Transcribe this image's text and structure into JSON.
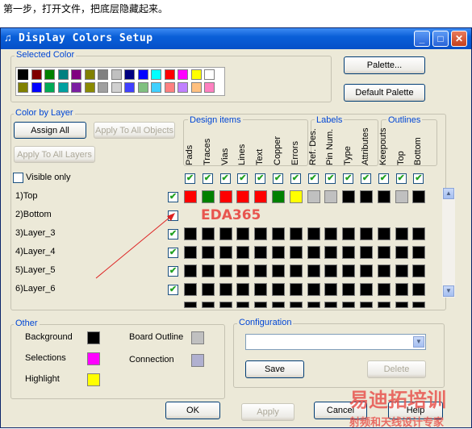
{
  "caption": "第一步，打开文件，把底层隐藏起来。",
  "window": {
    "title": "Display Colors Setup",
    "min": "_",
    "max": "□",
    "close": "✕",
    "app_icon": "♫"
  },
  "selected_color": {
    "label": "Selected Color",
    "palette_row1": [
      "#000000",
      "#800000",
      "#008000",
      "#008080",
      "#800080",
      "#808000",
      "#808080",
      "#c0c0c0",
      "#000080",
      "#0000ff",
      "#00ffff",
      "#ff0000",
      "#ff00ff",
      "#ffff00",
      "#ffffff"
    ],
    "palette_row2": [
      "#808000",
      "#0000ff",
      "#00aa55",
      "#00a0a0",
      "#7b1fa2",
      "#8a8a00",
      "#a0a0a0",
      "#d0d0d0",
      "#4040ff",
      "#80c080",
      "#40d0ff",
      "#ff8080",
      "#c080ff",
      "#ffc080",
      "#ff80c0"
    ],
    "palette_button": "Palette...",
    "default_palette_button": "Default Palette"
  },
  "color_by_layer": {
    "label": "Color by Layer",
    "assign_all": "Assign All",
    "apply_to_all_objects": "Apply To All Objects",
    "apply_to_all_layers": "Apply To All Layers",
    "visible_only": "Visible only",
    "groups": {
      "design_items": "Design items",
      "labels": "Labels",
      "outlines": "Outlines"
    },
    "columns": [
      "Pads",
      "Traces",
      "Vias",
      "Lines",
      "Text",
      "Copper",
      "Errors",
      "Ref. Des.",
      "Pin Num.",
      "Type",
      "Attributes",
      "Keepouts",
      "Top",
      "Bottom"
    ],
    "rows": [
      {
        "name": "1)Top",
        "checked": true,
        "colors": [
          "#ff0000",
          "#008000",
          "#ff0000",
          "#ff0000",
          "#ff0000",
          "#008000",
          "#ffff00",
          "#c0c0c0",
          "#c0c0c0",
          "#000000",
          "#000000",
          "#000000",
          "#c0c0c0",
          "#000000"
        ]
      },
      {
        "name": "2)Bottom",
        "checked": false,
        "colors": []
      },
      {
        "name": "3)Layer_3",
        "checked": true,
        "colors": [
          "#000000",
          "#000000",
          "#000000",
          "#000000",
          "#000000",
          "#000000",
          "#000000",
          "#000000",
          "#000000",
          "#000000",
          "#000000",
          "#000000",
          "#000000",
          "#000000"
        ]
      },
      {
        "name": "4)Layer_4",
        "checked": true,
        "colors": [
          "#000000",
          "#000000",
          "#000000",
          "#000000",
          "#000000",
          "#000000",
          "#000000",
          "#000000",
          "#000000",
          "#000000",
          "#000000",
          "#000000",
          "#000000",
          "#000000"
        ]
      },
      {
        "name": "5)Layer_5",
        "checked": true,
        "colors": [
          "#000000",
          "#000000",
          "#000000",
          "#000000",
          "#000000",
          "#000000",
          "#000000",
          "#000000",
          "#000000",
          "#000000",
          "#000000",
          "#000000",
          "#000000",
          "#000000"
        ]
      },
      {
        "name": "6)Layer_6",
        "checked": true,
        "colors": [
          "#000000",
          "#000000",
          "#000000",
          "#000000",
          "#000000",
          "#000000",
          "#000000",
          "#000000",
          "#000000",
          "#000000",
          "#000000",
          "#000000",
          "#000000",
          "#000000"
        ]
      }
    ],
    "partial_row_colors": [
      "#000000",
      "#000000",
      "#000000",
      "#000000",
      "#000000",
      "#000000",
      "#000000",
      "#000000",
      "#000000",
      "#000000",
      "#000000",
      "#000000",
      "#000000",
      "#000000"
    ]
  },
  "other": {
    "label": "Other",
    "background": "Background",
    "background_color": "#000000",
    "selections": "Selections",
    "selections_color": "#ff00ff",
    "highlight": "Highlight",
    "highlight_color": "#ffff00",
    "board_outline": "Board Outline",
    "board_outline_color": "#c0c0c0",
    "connection": "Connection",
    "connection_color": "#b0b0d0"
  },
  "configuration": {
    "label": "Configuration",
    "value": "",
    "save": "Save",
    "delete": "Delete"
  },
  "footer": {
    "ok": "OK",
    "apply": "Apply",
    "cancel": "Cancel",
    "help": "Help"
  },
  "annotation": {
    "text": "EDA365"
  },
  "watermark": {
    "line1": "易迪拓培训",
    "line2": "射频和天线设计专家"
  }
}
